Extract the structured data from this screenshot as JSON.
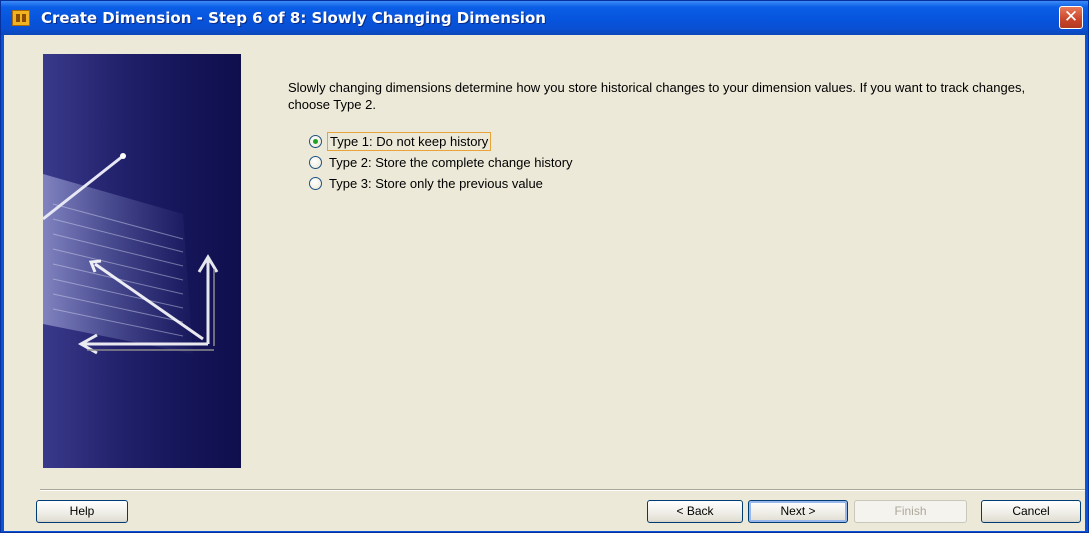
{
  "window": {
    "title": "Create Dimension - Step 6 of 8: Slowly Changing Dimension",
    "close_glyph": "✕"
  },
  "content": {
    "description": "Slowly changing dimensions determine how you store historical changes to your dimension values. If you want to track changes, choose Type 2.",
    "options": [
      {
        "label": "Type 1: Do not keep history",
        "checked": true
      },
      {
        "label": "Type 2: Store the complete change history",
        "checked": false
      },
      {
        "label": "Type 3: Store only the previous value",
        "checked": false
      }
    ]
  },
  "buttons": {
    "help": "Help",
    "back": "< Back",
    "next": "Next >",
    "finish": "Finish",
    "cancel": "Cancel"
  },
  "colors": {
    "titlebar": "#0754dd",
    "dialog_bg": "#ece9d8",
    "selected_radio": "#21a121",
    "focus_outline": "#e8a33a"
  }
}
